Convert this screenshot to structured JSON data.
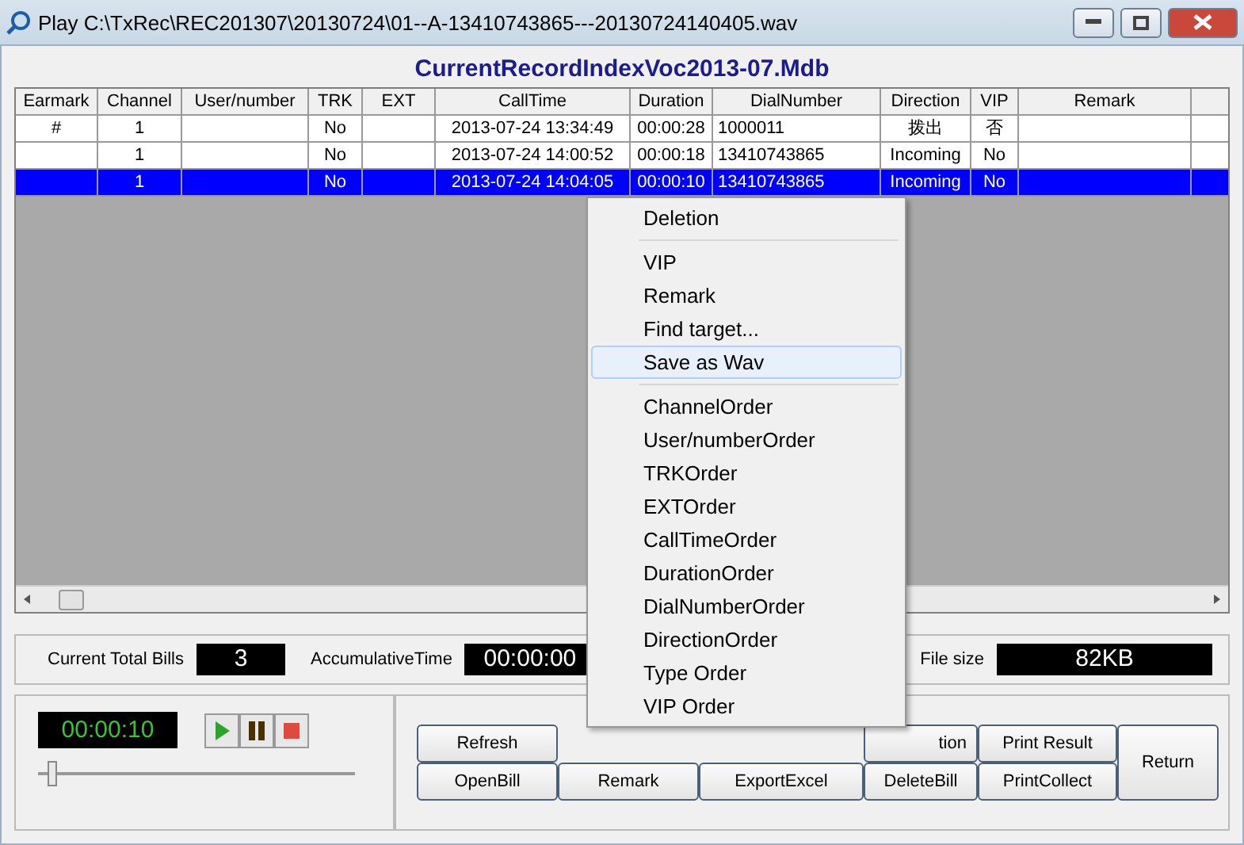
{
  "window": {
    "title": "Play  C:\\TxRec\\REC201307\\20130724\\01--A-13410743865---20130724140405.wav"
  },
  "table": {
    "title": "CurrentRecordIndexVoc2013-07.Mdb",
    "columns": [
      "Earmark",
      "Channel",
      "User/number",
      "TRK",
      "EXT",
      "CallTime",
      "Duration",
      "DialNumber",
      "Direction",
      "VIP",
      "Remark"
    ],
    "rows": [
      {
        "cells": [
          "#",
          "1",
          "",
          "No",
          "",
          "2013-07-24 13:34:49",
          "00:00:28",
          "1000011",
          "拨出",
          "否",
          ""
        ],
        "selected": false
      },
      {
        "cells": [
          "",
          "1",
          "",
          "No",
          "",
          "2013-07-24 14:00:52",
          "00:00:18",
          "13410743865",
          "Incoming",
          "No",
          ""
        ],
        "selected": false
      },
      {
        "cells": [
          "",
          "1",
          "",
          "No",
          "",
          "2013-07-24 14:04:05",
          "00:00:10",
          "13410743865",
          "Incoming",
          "No",
          ""
        ],
        "selected": true
      }
    ]
  },
  "info": {
    "total_label": "Current Total Bills",
    "total": "3",
    "time_label": "AccumulativeTime",
    "time": "00:00:00",
    "size_label": "File size",
    "size": "82KB"
  },
  "player": {
    "time": "00:00:10",
    "level": 0.03
  },
  "buttons_top": [
    "Refresh",
    "tion",
    "Print Result"
  ],
  "buttons_bottom": [
    "OpenBill",
    "Remark",
    "ExportExcel",
    "DeleteBill",
    "PrintCollect"
  ],
  "return_button": "Return",
  "context_menu": [
    {
      "label": "Deletion",
      "selected": false,
      "separator_after": true
    },
    {
      "label": "VIP",
      "selected": false,
      "separator_after": false
    },
    {
      "label": "Remark",
      "selected": false,
      "separator_after": false
    },
    {
      "label": "Find target...",
      "selected": false,
      "separator_after": false
    },
    {
      "label": "Save as Wav",
      "selected": true,
      "separator_after": true
    },
    {
      "label": "ChannelOrder",
      "selected": false,
      "separator_after": false
    },
    {
      "label": "User/numberOrder",
      "selected": false,
      "separator_after": false
    },
    {
      "label": "TRKOrder",
      "selected": false,
      "separator_after": false
    },
    {
      "label": "EXTOrder",
      "selected": false,
      "separator_after": false
    },
    {
      "label": "CallTimeOrder",
      "selected": false,
      "separator_after": false
    },
    {
      "label": "DurationOrder",
      "selected": false,
      "separator_after": false
    },
    {
      "label": "DialNumberOrder",
      "selected": false,
      "separator_after": false
    },
    {
      "label": "DirectionOrder",
      "selected": false,
      "separator_after": false
    },
    {
      "label": "Type Order",
      "selected": false,
      "separator_after": false
    },
    {
      "label": "VIP Order",
      "selected": false,
      "separator_after": false
    }
  ]
}
